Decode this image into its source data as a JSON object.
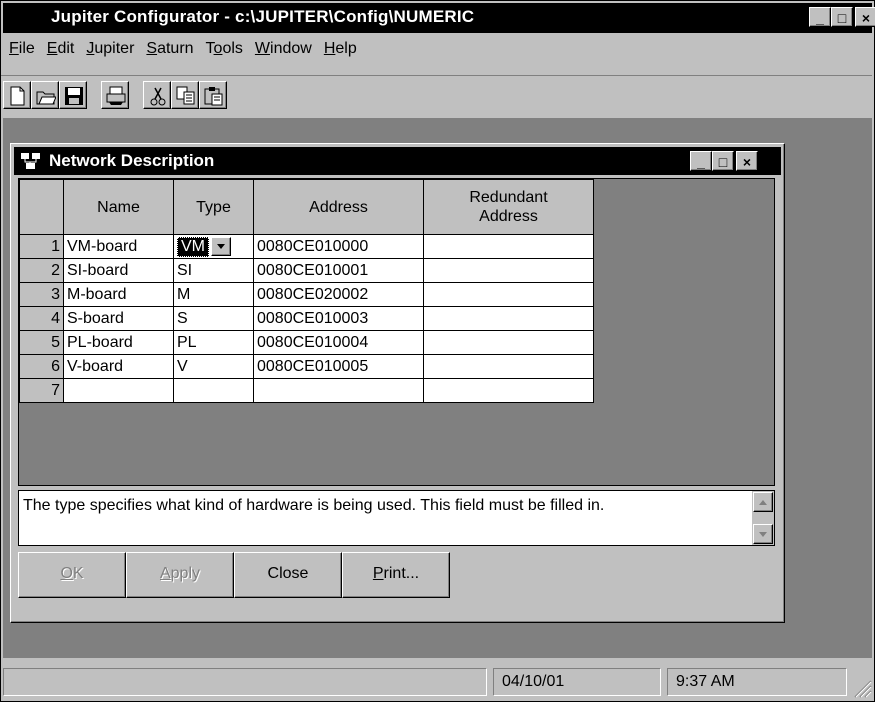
{
  "app": {
    "title": "Jupiter Configurator - c:\\JUPITER\\Config\\NUMERIC"
  },
  "window_controls": {
    "minimize": "_",
    "maximize": "□",
    "close": "×"
  },
  "menu": [
    {
      "label": "File",
      "key": "F",
      "rest": "ile"
    },
    {
      "label": "Edit",
      "key": "E",
      "rest": "dit"
    },
    {
      "label": "Jupiter",
      "key": "J",
      "rest": "upiter"
    },
    {
      "label": "Saturn",
      "key": "S",
      "rest": "aturn"
    },
    {
      "label": "Tools",
      "pre": "T",
      "key": "o",
      "rest": "ols"
    },
    {
      "label": "Window",
      "key": "W",
      "rest": "indow"
    },
    {
      "label": "Help",
      "key": "H",
      "rest": "elp"
    }
  ],
  "toolbar": {
    "icons": [
      "new-file-icon",
      "open-folder-icon",
      "save-disk-icon",
      "print-icon",
      "cut-scissors-icon",
      "copy-icon",
      "paste-clipboard-icon"
    ]
  },
  "child": {
    "title": "Network Description",
    "columns": [
      "Name",
      "Type",
      "Address",
      "Redundant Address"
    ],
    "rows": [
      {
        "num": "1",
        "name": "VM-board",
        "type": "VM",
        "address": "0080CE010000",
        "redundant": ""
      },
      {
        "num": "2",
        "name": "SI-board",
        "type": "SI",
        "address": "0080CE010001",
        "redundant": ""
      },
      {
        "num": "3",
        "name": "M-board",
        "type": "M",
        "address": "0080CE020002",
        "redundant": ""
      },
      {
        "num": "4",
        "name": "S-board",
        "type": "S",
        "address": "0080CE010003",
        "redundant": ""
      },
      {
        "num": "5",
        "name": "PL-board",
        "type": "PL",
        "address": "0080CE010004",
        "redundant": ""
      },
      {
        "num": "6",
        "name": "V-board",
        "type": "V",
        "address": "0080CE010005",
        "redundant": ""
      },
      {
        "num": "7",
        "name": "",
        "type": "",
        "address": "",
        "redundant": ""
      }
    ],
    "help_text": "The type specifies what kind of hardware is being used.  This field must be filled in.",
    "buttons": {
      "ok": {
        "key": "O",
        "rest": "K",
        "enabled": false
      },
      "apply": {
        "key": "A",
        "rest": "pply",
        "enabled": false
      },
      "close": {
        "label": "Close",
        "enabled": true
      },
      "print": {
        "key": "P",
        "rest": "rint...",
        "enabled": true
      }
    }
  },
  "status": {
    "message": "",
    "date": "04/10/01",
    "time": "9:37 AM"
  }
}
